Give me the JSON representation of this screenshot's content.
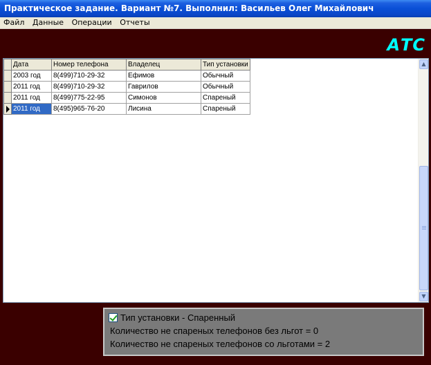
{
  "window": {
    "title": "Практическое задание. Вариант №7. Выполнил: Васильев Олег Михайлович"
  },
  "menu": {
    "items": [
      "Файл",
      "Данные",
      "Операции",
      "Отчеты"
    ]
  },
  "logo": {
    "text": "АТС",
    "color": "#00ffff"
  },
  "grid": {
    "columns": [
      "Дата",
      "Номер телефона",
      "Владелец",
      "Тип установки"
    ],
    "rows": [
      [
        "2003 год",
        "8(499)710-29-32",
        "Ефимов",
        "Обычный"
      ],
      [
        "2011 год",
        "8(499)710-29-32",
        "Гаврилов",
        "Обычный"
      ],
      [
        "2011 год",
        "8(499)775-22-95",
        "Симонов",
        "Спареный"
      ],
      [
        "2011 год",
        "8(495)965-76-20",
        "Лисина",
        "Спареный"
      ]
    ],
    "current_row": 4
  },
  "info": {
    "checkbox_label": "Тип установки - Спаренный",
    "checkbox_checked": true,
    "line1": "Количество не спареных телефонов без льгот = 0",
    "line2": "Количество не спареных телефонов со льготами = 2"
  },
  "colors": {
    "background": "#3a0000",
    "title_bar": "#0a4fd6",
    "selection": "#316ac5",
    "panel": "#7a7a7a"
  }
}
